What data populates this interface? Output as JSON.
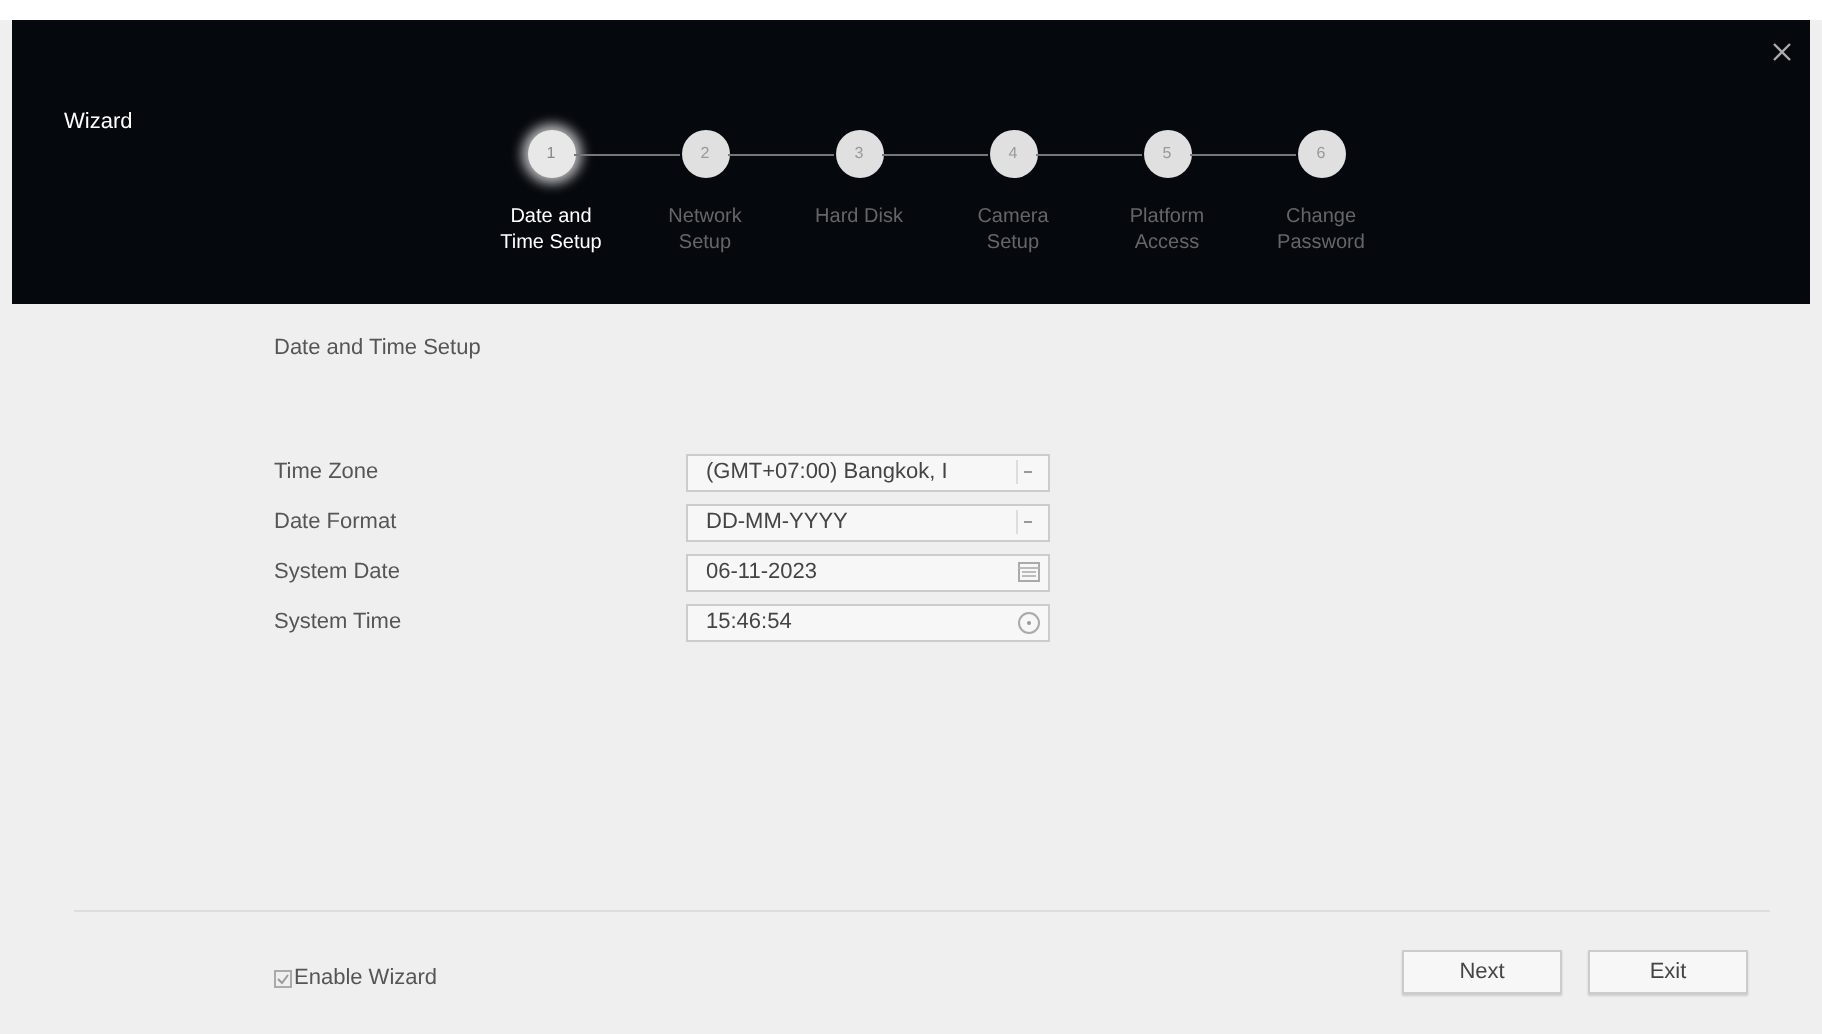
{
  "window": {
    "title": "Wizard"
  },
  "steps": [
    {
      "number": "1",
      "label": "Date and Time Setup",
      "selected": true
    },
    {
      "number": "2",
      "label": "Network Setup",
      "selected": false
    },
    {
      "number": "3",
      "label": "Hard Disk",
      "selected": false
    },
    {
      "number": "4",
      "label": "Camera Setup",
      "selected": false
    },
    {
      "number": "5",
      "label": "Platform Access",
      "selected": false
    },
    {
      "number": "6",
      "label": "Change Password",
      "selected": false
    }
  ],
  "section_title": "Date and Time Setup",
  "fields": [
    {
      "label": "Time Zone",
      "kind": "dropdown",
      "value": "(GMT+07:00) Bangkok, I"
    },
    {
      "label": "Date Format",
      "kind": "dropdown",
      "value": "DD-MM-YYYY"
    },
    {
      "label": "System Date",
      "kind": "date",
      "value": "06-11-2023"
    },
    {
      "label": "System Time",
      "kind": "time",
      "value": "15:46:54"
    }
  ],
  "enable_wizard": {
    "label": "Enable Wizard",
    "checked": true
  },
  "buttons": [
    "Next",
    "Exit"
  ]
}
